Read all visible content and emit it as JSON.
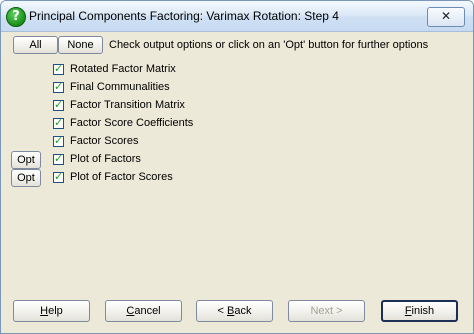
{
  "window": {
    "title": "Principal Components Factoring: Varimax Rotation: Step 4",
    "close_symbol": "✕"
  },
  "toolbar": {
    "all_label": "All",
    "none_label": "None",
    "hint": "Check output options or click on an 'Opt' button for further options"
  },
  "options": [
    {
      "label": "Rotated Factor Matrix",
      "checked": true,
      "has_opt": false
    },
    {
      "label": "Final Communalities",
      "checked": true,
      "has_opt": false
    },
    {
      "label": "Factor Transition Matrix",
      "checked": true,
      "has_opt": false
    },
    {
      "label": "Factor Score Coefficients",
      "checked": true,
      "has_opt": false
    },
    {
      "label": "Factor Scores",
      "checked": true,
      "has_opt": false
    },
    {
      "label": "Plot of Factors",
      "checked": true,
      "has_opt": true
    },
    {
      "label": "Plot of Factor Scores",
      "checked": true,
      "has_opt": true
    }
  ],
  "opt_label": "Opt",
  "buttons": {
    "help": {
      "accel": "H",
      "rest": "elp"
    },
    "cancel": {
      "accel": "C",
      "rest": "ancel"
    },
    "back": {
      "prefix": "< ",
      "accel": "B",
      "rest": "ack"
    },
    "next": {
      "text": "Next >"
    },
    "finish": {
      "accel": "F",
      "rest": "inish"
    }
  }
}
